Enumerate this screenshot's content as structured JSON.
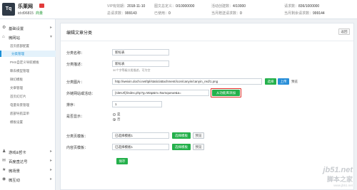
{
  "brand": {
    "logo_text": "Tq",
    "site_name": "乐莱网",
    "site_id": "id:d96815",
    "site_status": "商量"
  },
  "stats": [
    {
      "key": "VIP有效期：",
      "value": "2018-11-10"
    },
    {
      "key": "图文总定义：",
      "value": "0/10000000"
    },
    {
      "key": "活动创建数：",
      "value": "4/10000"
    },
    {
      "key": "请求数：",
      "value": "836/1000000"
    },
    {
      "key": "总请求数：",
      "value": "999143"
    },
    {
      "key": "已使用：",
      "value": "0"
    },
    {
      "key": "当月赠送请求数：",
      "value": "0"
    },
    {
      "key": "当月剩余请求数：",
      "value": "999144"
    }
  ],
  "sidebar": {
    "groups": [
      {
        "icon": "⚙",
        "label": "基础设置",
        "chevron": "▸"
      },
      {
        "icon": "⌂",
        "label": "微网站",
        "chevron": "▾"
      },
      {
        "icon": "♟",
        "label": "游戏&哲卡",
        "chevron": "▸"
      },
      {
        "icon": "✉",
        "label": "百度直达号",
        "chevron": "▸"
      },
      {
        "icon": "★",
        "label": "微场景",
        "chevron": "▸"
      },
      {
        "icon": "◉",
        "label": "微互动",
        "chevron": "▸"
      }
    ],
    "items": [
      "首页底部配置",
      "分类管理",
      "PHS自定义导航模板",
      "聊去模型管理",
      "微幻模板",
      "文章管理",
      "首页幻灯片",
      "电量背景管理",
      "底部导航菜单",
      "模板设置"
    ]
  },
  "main": {
    "title": "编辑文章分类",
    "back_label": "返回",
    "fields": {
      "name_label": "分类名称：",
      "name_value": "新标表",
      "summary_label": "分类描述：",
      "summary_value": "新标表",
      "summary_hint": "30个字等级分类描述，可为空",
      "image_label": "分类图片：",
      "image_value": "http://weixin.dochi.net/tpl/static/attachment/icon/canyin/canyin_red/1.png",
      "select_label": "选择",
      "upload_label": "上传",
      "preview_label": "预览",
      "link_label": "外链网站或活动：",
      "link_value": "{siteUrl}/index.php?g=Wap&m=Numqueue&a=",
      "link_button": "从功能库添加",
      "sort_label": "排序：",
      "sort_value": "1",
      "show_label": "是否显示：",
      "show_yes": "是",
      "show_no": "否",
      "list_tpl_label": "分类页模板：",
      "list_tpl_value": "已选择模板1",
      "content_tpl_label": "内容页模板：",
      "content_tpl_value": "已选择模板1",
      "choose_tpl": "选择模板",
      "preview": "预览",
      "save_label": "保存"
    }
  },
  "watermark": {
    "line1": "jb51.net",
    "line2": "脚本之家",
    "line3": "www.jb51.net"
  }
}
